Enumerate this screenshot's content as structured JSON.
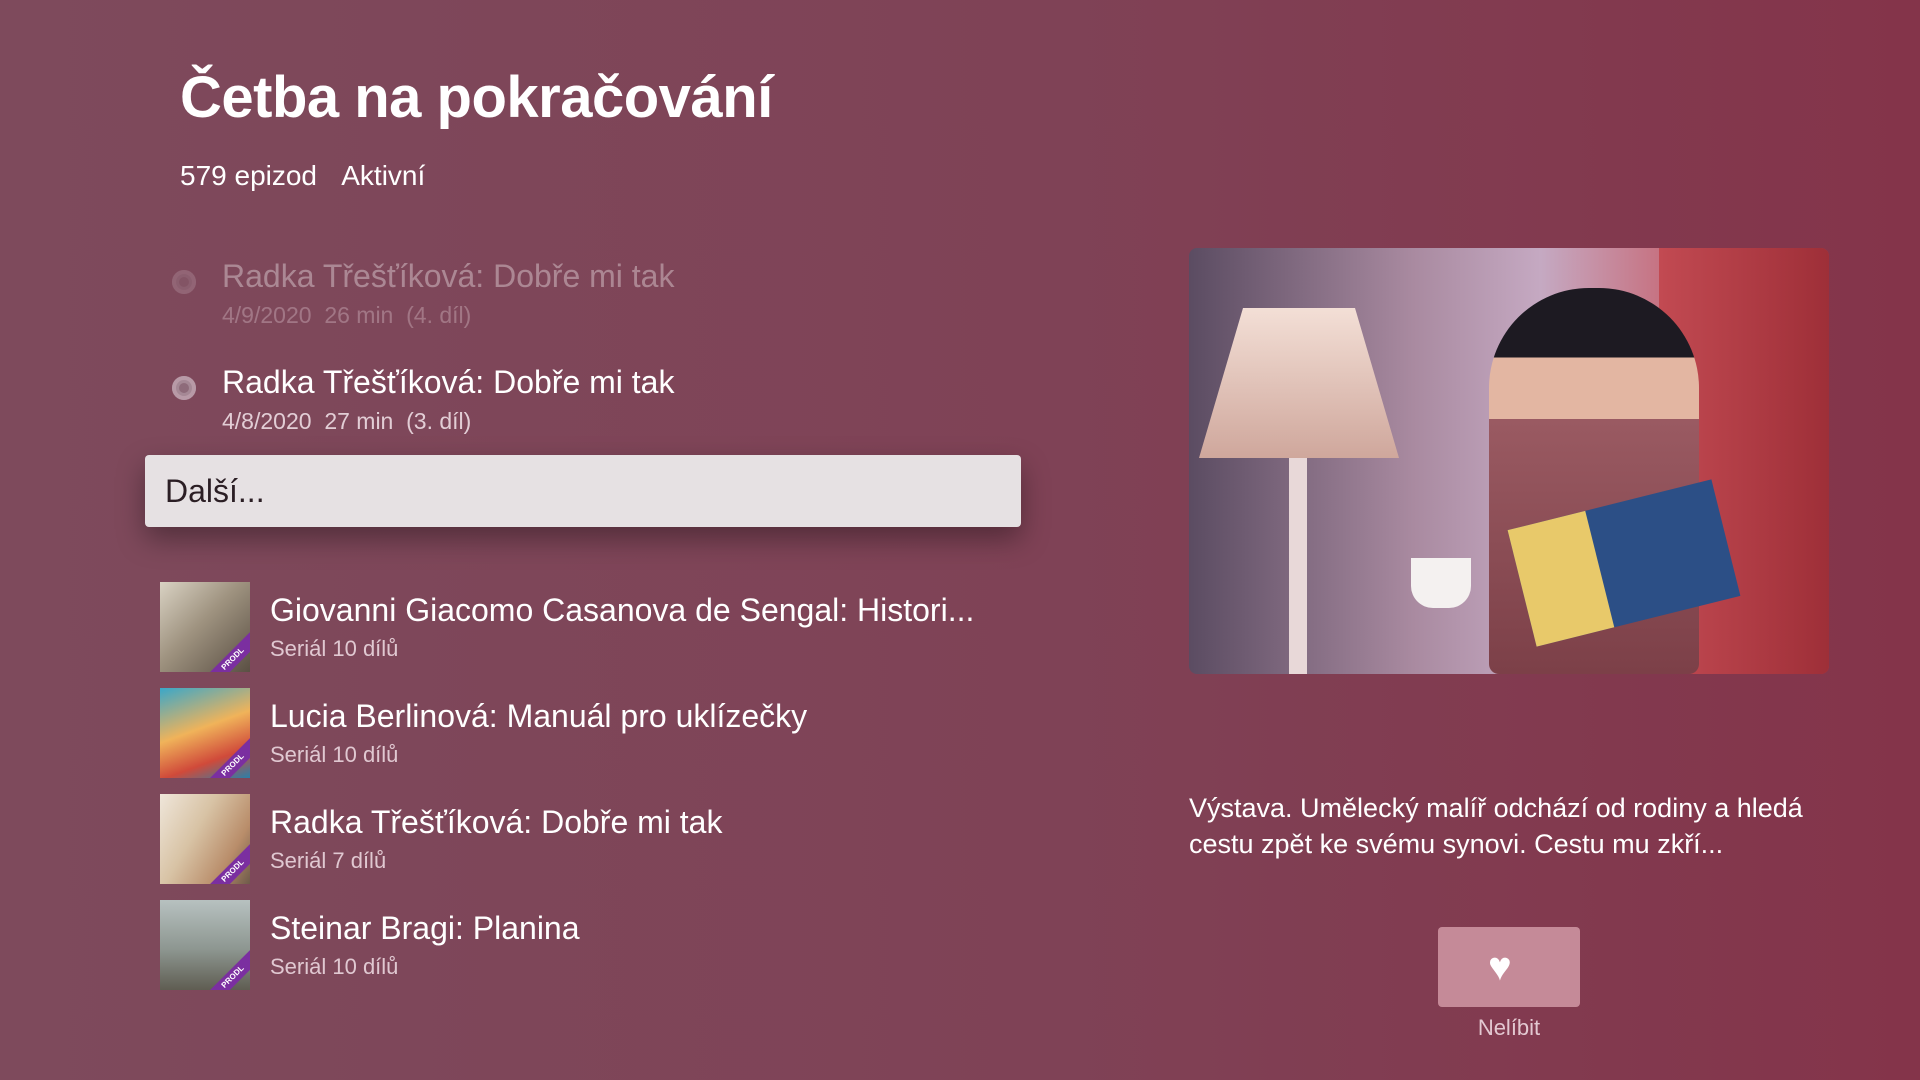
{
  "header": {
    "title": "Četba na pokračování",
    "episode_count": "579 epizod",
    "status": "Aktivní"
  },
  "episodes": [
    {
      "title": "Radka Třešťíková: Dobře mi tak",
      "date": "4/9/2020",
      "duration": "26 min",
      "part": "(4. díl)"
    },
    {
      "title": "Radka Třešťíková: Dobře mi tak",
      "date": "4/8/2020",
      "duration": "27 min",
      "part": "(3. díl)"
    }
  ],
  "more_button": {
    "label": "Další..."
  },
  "series": [
    {
      "title": "Giovanni Giacomo Casanova de Sengal: Histori...",
      "subtitle": "Seriál 10 dílů",
      "badge": "PRODL"
    },
    {
      "title": "Lucia Berlinová: Manuál pro uklízečky",
      "subtitle": "Seriál 10 dílů",
      "badge": "PRODL"
    },
    {
      "title": "Radka Třešťíková: Dobře mi tak",
      "subtitle": "Seriál 7 dílů",
      "badge": "PRODL"
    },
    {
      "title": "Steinar Bragi: Planina",
      "subtitle": "Seriál 10 dílů",
      "badge": "PRODL"
    }
  ],
  "detail": {
    "description": "Výstava. Umělecký malíř odchází od rodiny a hledá cestu zpět ke svému synovi. Cestu mu zkří...",
    "like_icon": "heart-icon",
    "like_label": "Nelíbit"
  },
  "colors": {
    "background": "#7f4256",
    "accent": "#c58a98",
    "badge": "#7b2fa0"
  }
}
